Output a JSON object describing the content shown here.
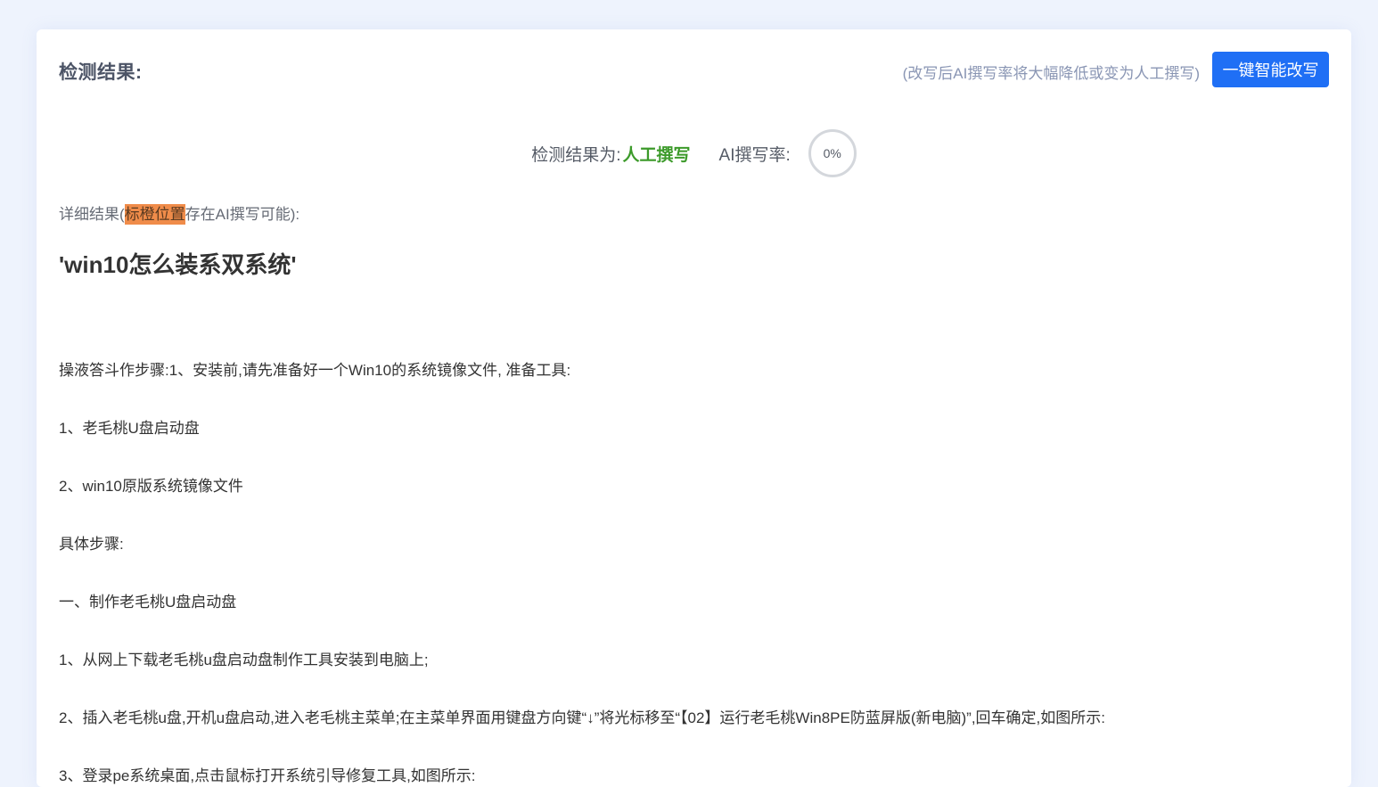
{
  "header": {
    "title": "检测结果:",
    "hint": "(改写后AI撰写率将大幅降低或变为人工撰写)",
    "rewrite_button": "一键智能改写"
  },
  "result": {
    "label": "检测结果为:",
    "value": "人工撰写",
    "rate_label": "AI撰写率:",
    "rate_value": "0%",
    "rate_percent": 0
  },
  "detail": {
    "prefix": "详细结果(",
    "highlight": "标橙位置",
    "suffix": "存在AI撰写可能):"
  },
  "document": {
    "title": "'win10怎么装系双系统'",
    "paragraphs": [
      "操液答斗作步骤:1、安装前,请先准备好一个Win10的系统镜像文件, 准备工具:",
      "1、老毛桃U盘启动盘",
      "2、win10原版系统镜像文件",
      "具体步骤:",
      "一、制作老毛桃U盘启动盘",
      "1、从网上下载老毛桃u盘启动盘制作工具安装到电脑上;",
      "2、插入老毛桃u盘,开机u盘启动,进入老毛桃主菜单;在主菜单界面用键盘方向键“↓”将光标移至“【02】运行老毛桃Win8PE防蓝屏版(新电脑)”,回车确定,如图所示:",
      "3、登录pe系统桌面,点击鼠标打开系统引导修复工具,如图所示:"
    ]
  },
  "colors": {
    "accent": "#1f6ff5",
    "human_result": "#3c9a2a",
    "highlight": "#f08c4a",
    "hint": "#8a96b4"
  }
}
